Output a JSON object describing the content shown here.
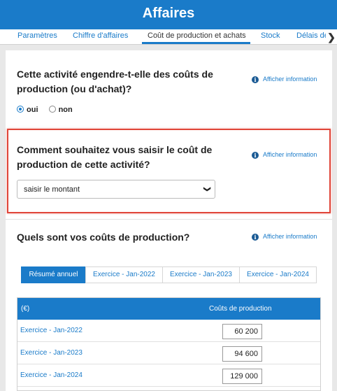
{
  "header": {
    "title": "Affaires"
  },
  "tabs": [
    {
      "label": "Paramètres"
    },
    {
      "label": "Chiffre d'affaires"
    },
    {
      "label": "Coût de production et achats"
    },
    {
      "label": "Stock"
    },
    {
      "label": "Délais de"
    }
  ],
  "tab_arrow": "❯",
  "info_label": "Afficher information",
  "info_icon": "info-icon",
  "q1": {
    "text": "Cette activité engendre-t-elle des coûts de production (ou d'achat)?",
    "options": [
      {
        "label": "oui",
        "checked": true
      },
      {
        "label": "non",
        "checked": false
      }
    ]
  },
  "q2": {
    "text": "Comment souhaitez vous saisir le coût de production de cette activité?",
    "select_value": "saisir le montant",
    "select_chevron": "❯"
  },
  "q3": {
    "text": "Quels sont vos coûts de production?",
    "period_tabs": [
      {
        "label": "Résumé annuel"
      },
      {
        "label": "Exercice - Jan-2022"
      },
      {
        "label": "Exercice - Jan-2023"
      },
      {
        "label": "Exercice - Jan-2024"
      }
    ],
    "table": {
      "headers": [
        "(€)",
        "Coûts de production"
      ],
      "rows": [
        {
          "label": "Exercice - Jan-2022",
          "value": "60 200"
        },
        {
          "label": "Exercice - Jan-2023",
          "value": "94 600"
        },
        {
          "label": "Exercice - Jan-2024",
          "value": "129 000"
        }
      ]
    }
  },
  "colors": {
    "primary": "#1a7bc9",
    "highlight_border": "#e0463a"
  }
}
